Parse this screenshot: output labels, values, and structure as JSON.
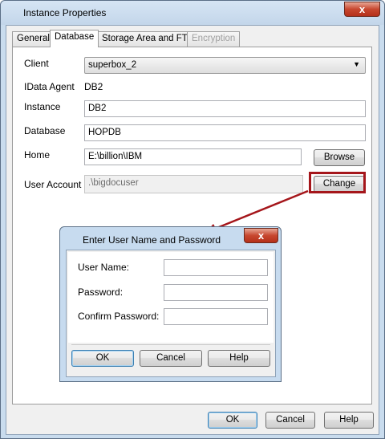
{
  "window": {
    "title": "Instance Properties",
    "close_symbol": "x"
  },
  "tabs": [
    {
      "label": "General",
      "state": "normal"
    },
    {
      "label": "Database",
      "state": "active"
    },
    {
      "label": "Storage Area and FTI",
      "state": "normal"
    },
    {
      "label": "Encryption",
      "state": "disabled"
    }
  ],
  "form": {
    "client_label": "Client",
    "client_value": "superbox_2",
    "idata_agent_label": "IData Agent",
    "idata_agent_value": "DB2",
    "instance_label": "Instance",
    "instance_value": "DB2",
    "database_label": "Database",
    "database_value": "HOPDB",
    "home_label": "Home",
    "home_value": "E:\\billion\\IBM",
    "browse_label": "Browse",
    "user_account_label": "User Account",
    "user_account_value": ".\\bigdocuser",
    "change_label": "Change"
  },
  "footer": {
    "ok_label": "OK",
    "cancel_label": "Cancel",
    "help_label": "Help"
  },
  "dialog": {
    "title": "Enter User Name and Password",
    "close_symbol": "x",
    "user_name_label": "User Name:",
    "user_name_value": "",
    "password_label": "Password:",
    "password_value": "",
    "confirm_password_label": "Confirm Password:",
    "confirm_password_value": "",
    "ok_label": "OK",
    "cancel_label": "Cancel",
    "help_label": "Help"
  },
  "colors": {
    "highlight": "#a5161b",
    "titlebar": "#c9dcee"
  }
}
